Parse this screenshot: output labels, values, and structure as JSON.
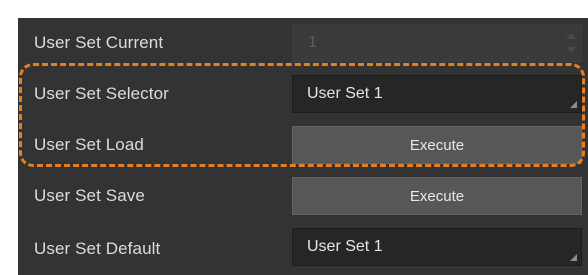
{
  "rows": [
    {
      "label": "User Set Current",
      "value": "1"
    },
    {
      "label": "User Set Selector",
      "value": "User Set 1"
    },
    {
      "label": "User Set Load",
      "button_label": "Execute"
    },
    {
      "label": "User Set Save",
      "button_label": "Execute"
    },
    {
      "label": "User Set Default",
      "value": "User Set 1"
    }
  ],
  "colors": {
    "panel_background": "#333333",
    "highlight_border": "#e67e22",
    "button_background": "#575757",
    "select_background": "#262626"
  },
  "icons": {
    "spinner_up": "spinner-up-icon",
    "spinner_down": "spinner-down-icon",
    "dropdown_corner": "dropdown-corner-icon"
  }
}
